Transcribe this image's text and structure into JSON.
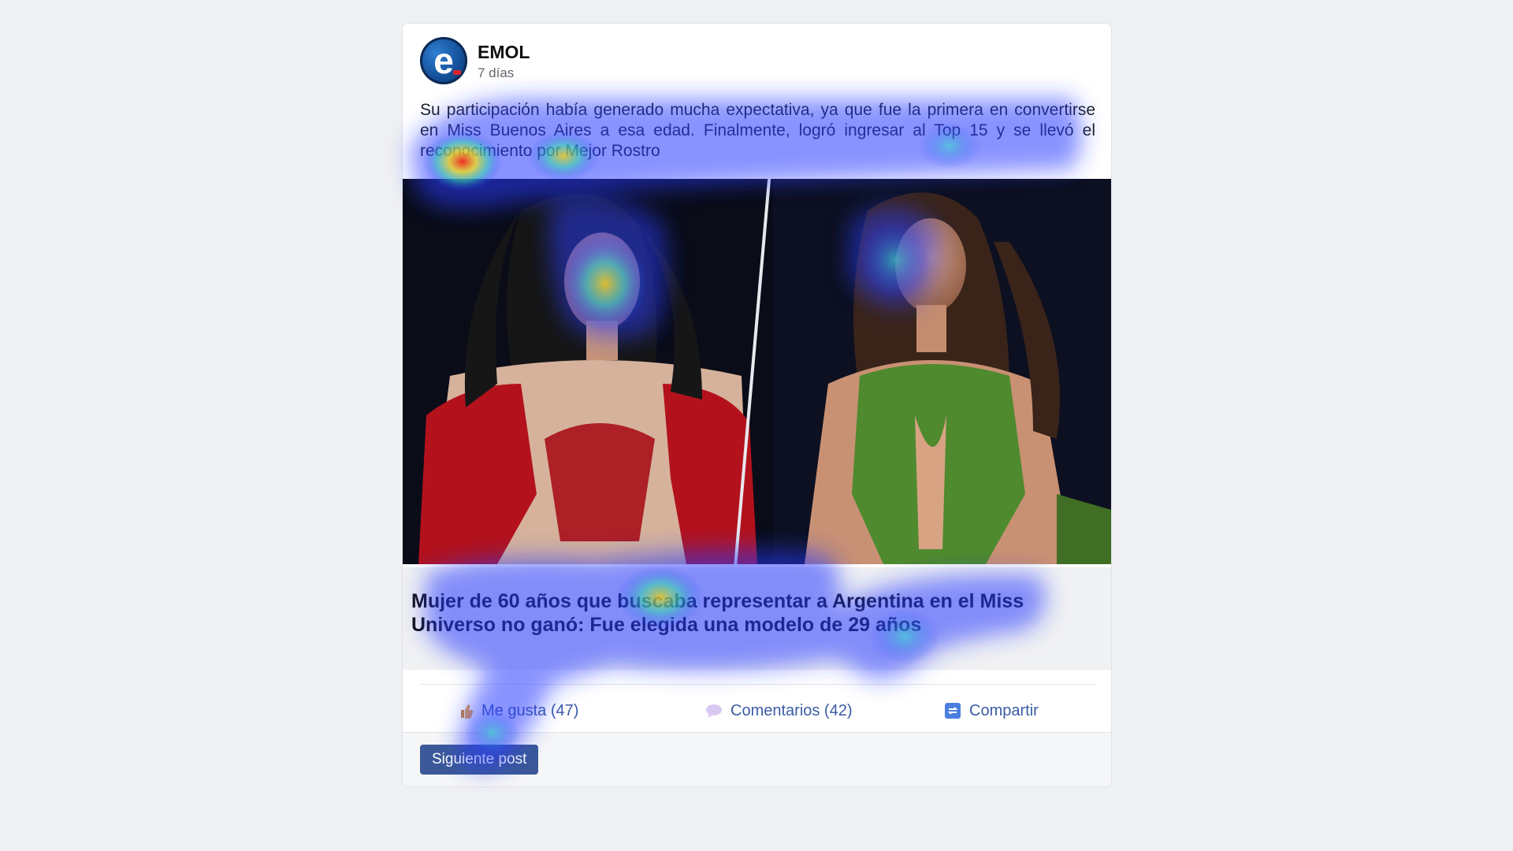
{
  "post": {
    "page_name": "EMOL",
    "time": "7 días",
    "text": "Su participación había generado mucha expectativa, ya que fue la primera en convertirse en Miss Buenos Aires a esa edad. Finalmente, logró ingresar al Top 15 y se llevó el reconocimiento por Mejor Rostro",
    "link_title": "Mujer de 60 años que buscaba representar a Argentina en el Miss Universo no ganó: Fue elegida una modelo de 29 años"
  },
  "actions": {
    "like": "Me gusta (47)",
    "comment": "Comentarios (42)",
    "share": "Compartir"
  },
  "footer": {
    "next_label": "Siguiente post"
  },
  "colors": {
    "page_bg": "#eff0f3",
    "link_blue": "#3b5ba5",
    "button_blue": "#3b5998",
    "dress_left": "#b3121c",
    "dress_right": "#4f8a2e"
  },
  "icons": [
    "like-icon",
    "comment-icon",
    "share-icon"
  ]
}
